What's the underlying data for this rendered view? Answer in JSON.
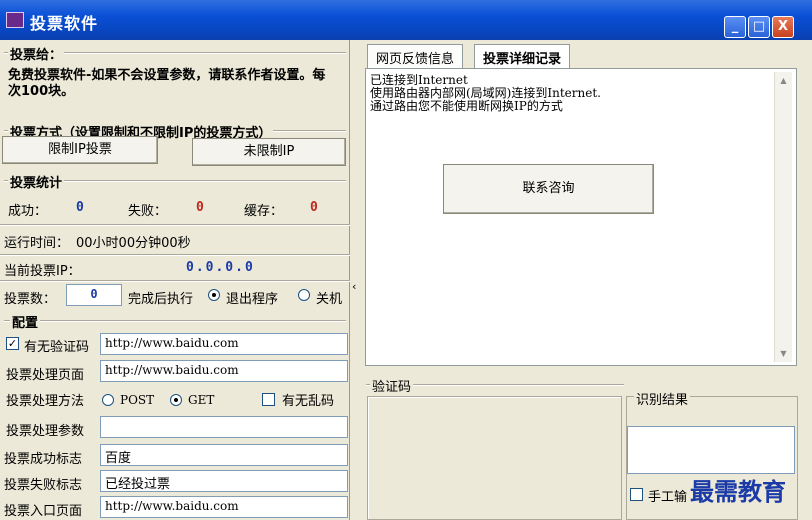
{
  "window": {
    "title": "投票软件",
    "buttons": {
      "minimize": "_",
      "maximize": "□",
      "close": "X"
    }
  },
  "vote_target": {
    "title": "投票给：",
    "description": "免费投票软件-如果不会设置参数，请联系作者设置。每次100块。"
  },
  "vote_mode": {
    "title": "投票方式（设置限制和不限制IP的投票方式）",
    "limited_label": "限制IP投票",
    "unlimited_label": "未限制IP"
  },
  "stats": {
    "title": "投票统计",
    "success_label": "成功：",
    "success_value": "0",
    "fail_label": "失败：",
    "fail_value": "0",
    "cache_label": "缓存：",
    "cache_value": "0",
    "runtime_label": "运行时间：",
    "runtime_value": "00小时00分钟00秒",
    "ip_label": "当前投票IP：",
    "ip_value": "0.0.0.0",
    "count_label": "投票数：",
    "count_value": "0",
    "after_label": "完成后执行",
    "exit_label": "退出程序",
    "shutdown_label": "关机"
  },
  "config": {
    "title": "配置",
    "captcha_label": "有无验证码",
    "captcha_url": "http://www.baidu.com",
    "process_page_label": "投票处理页面",
    "process_page_url": "http://www.baidu.com",
    "method_label": "投票处理方法",
    "post_label": "POST",
    "get_label": "GET",
    "garbled_label": "有无乱码",
    "params_label": "投票处理参数",
    "params_value": "",
    "success_flag_label": "投票成功标志",
    "success_flag_value": "百度",
    "fail_flag_label": "投票失败标志",
    "fail_flag_value": "已经投过票",
    "entry_page_label": "投票入口页面",
    "entry_page_url": "http://www.baidu.com"
  },
  "tabs": {
    "feedback": "网页反馈信息",
    "details": "投票详细记录"
  },
  "log_lines": [
    "已连接到Internet",
    "使用路由器内部网(局域网)连接到Internet.",
    "通过路由您不能使用断网换IP的方式"
  ],
  "contact_button": "联系咨询",
  "captcha": {
    "title": "验证码",
    "result_title": "识别结果",
    "manual_label": "手工输"
  },
  "watermark": "最需教育"
}
